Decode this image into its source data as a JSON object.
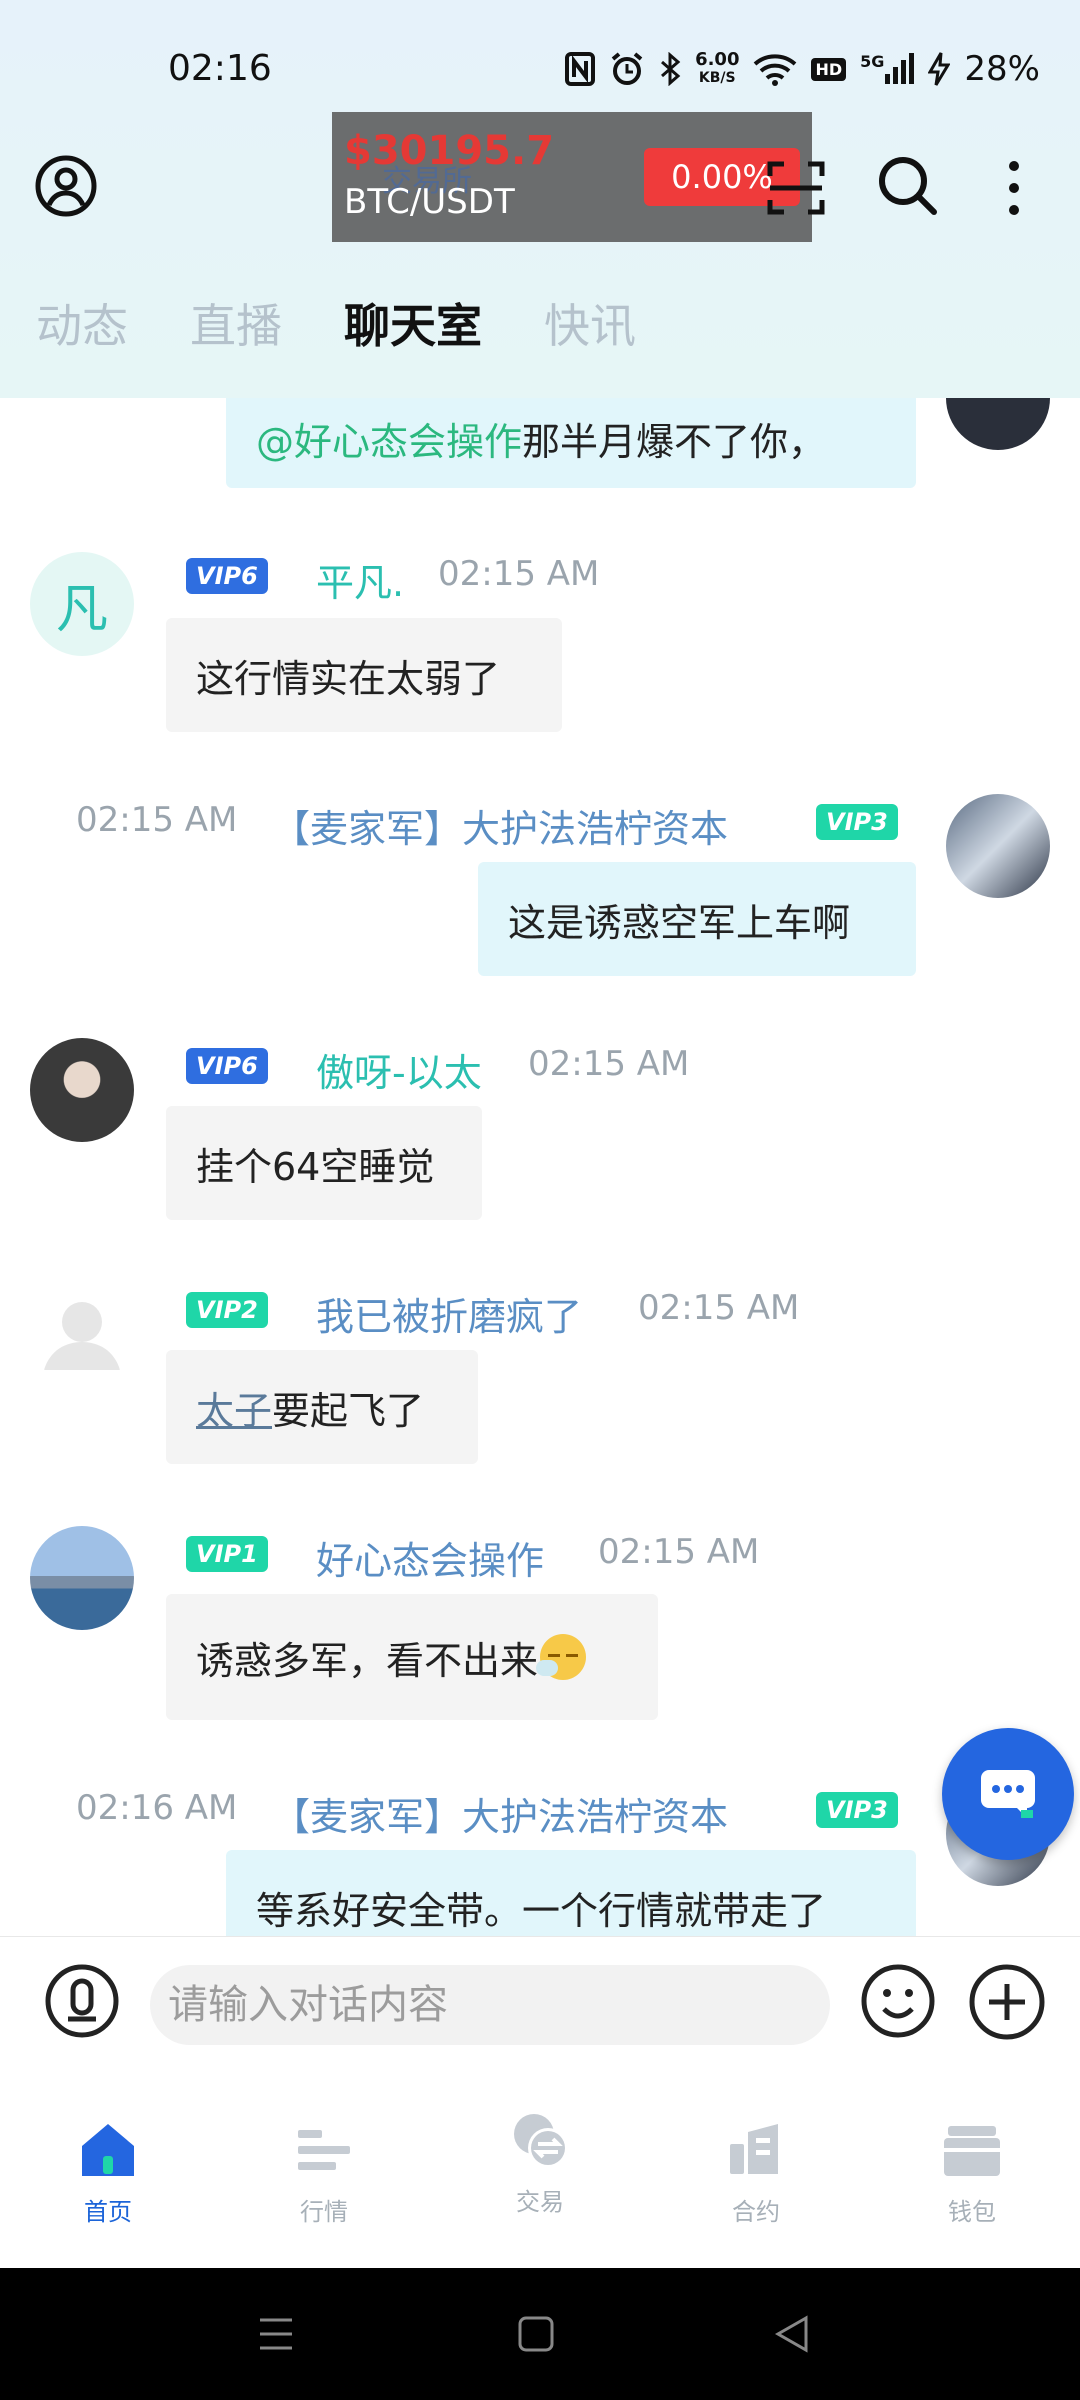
{
  "status_bar": {
    "time": "02:16",
    "net_speed_value": "6.00",
    "net_speed_unit": "KB/S",
    "hd": "HD",
    "signal": "5G",
    "battery": "28%"
  },
  "ticker": {
    "background_title": "交易所",
    "price": "$30195.7",
    "pair": "BTC/USDT",
    "change": "0.00%"
  },
  "tabs": [
    {
      "label": "动态"
    },
    {
      "label": "直播"
    },
    {
      "label": "聊天室"
    },
    {
      "label": "快讯"
    }
  ],
  "messages": [
    {
      "mention": "@好心态会操作",
      "text": "那半月爆不了你，"
    },
    {
      "avatar_char": "凡",
      "vip": "VIP6",
      "user": "平凡.",
      "time": "02:15 AM",
      "text": "这行情实在太弱了"
    },
    {
      "vip": "VIP3",
      "user": "【麦家军】大护法浩柠资本",
      "time": "02:15 AM",
      "text": "这是诱惑空军上车啊"
    },
    {
      "vip": "VIP6",
      "user": "傲呀-以太",
      "time": "02:15 AM",
      "text": "挂个64空睡觉"
    },
    {
      "vip": "VIP2",
      "user": "我已被折磨疯了",
      "time": "02:15 AM",
      "link": "太子",
      "text": "要起飞了"
    },
    {
      "vip": "VIP1",
      "user": "好心态会操作",
      "time": "02:15 AM",
      "text": "诱惑多军，看不出来"
    },
    {
      "vip": "VIP3",
      "user": "【麦家军】大护法浩柠资本",
      "time": "02:16 AM",
      "text": "等系好安全带。一个行情就带走了"
    }
  ],
  "input": {
    "placeholder": "请输入对话内容"
  },
  "bottom_nav": [
    {
      "label": "首页"
    },
    {
      "label": "行情"
    },
    {
      "label": "交易"
    },
    {
      "label": "合约"
    },
    {
      "label": "钱包"
    }
  ],
  "colors": {
    "accent": "#2466e0",
    "vip_blue": "#2f6ee0",
    "vip_green": "#1fd6a8",
    "teal_name": "#2bbfb0",
    "red": "#ef3b3b"
  }
}
